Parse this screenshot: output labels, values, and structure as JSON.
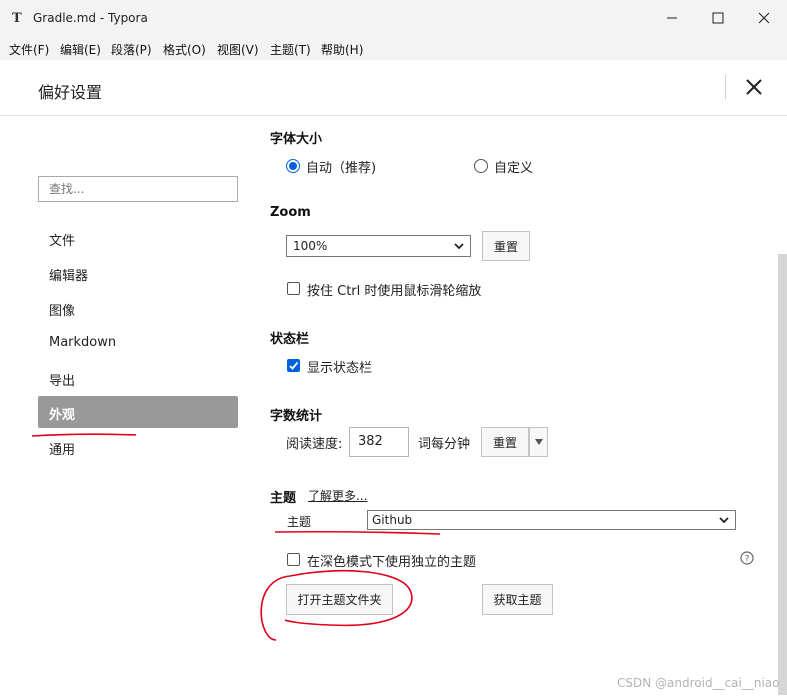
{
  "window": {
    "title": "Gradle.md - Typora",
    "app_icon_glyph": "T"
  },
  "menu": [
    "文件(F)",
    "编辑(E)",
    "段落(P)",
    "格式(O)",
    "视图(V)",
    "主题(T)",
    "帮助(H)"
  ],
  "dialog": {
    "title": "偏好设置"
  },
  "sidebar": {
    "search_placeholder": "查找...",
    "items": [
      {
        "label": "文件",
        "active": false
      },
      {
        "label": "编辑器",
        "active": false
      },
      {
        "label": "图像",
        "active": false
      },
      {
        "label": "Markdown",
        "active": false
      },
      {
        "label": "导出",
        "active": false
      },
      {
        "label": "外观",
        "active": true
      },
      {
        "label": "通用",
        "active": false
      }
    ]
  },
  "font_size": {
    "title": "字体大小",
    "options": [
      {
        "label": "自动（推荐)",
        "checked": true
      },
      {
        "label": "自定义",
        "checked": false
      }
    ]
  },
  "zoom": {
    "title": "Zoom",
    "value": "100%",
    "reset_label": "重置",
    "ctrl_wheel_label": "按住 Ctrl 时使用鼠标滑轮缩放",
    "ctrl_wheel_checked": false
  },
  "status_bar": {
    "title": "状态栏",
    "show_label": "显示状态栏",
    "show_checked": true
  },
  "word_count": {
    "title": "字数统计",
    "speed_label": "阅读速度:",
    "speed_value": "382",
    "unit_label": "词每分钟",
    "reset_label": "重置"
  },
  "theme": {
    "title": "主题",
    "learn_more": "了解更多...",
    "theme_label": "主题",
    "theme_value": "Github",
    "dark_mode_label": "在深色模式下使用独立的主题",
    "dark_mode_checked": false,
    "open_folder_label": "打开主题文件夹",
    "get_themes_label": "获取主题",
    "help_glyph": "?"
  },
  "watermark": "CSDN @android__cai__niao",
  "colors": {
    "accent": "#0060df",
    "active_nav": "#999999",
    "annotation": "#e0001a"
  }
}
